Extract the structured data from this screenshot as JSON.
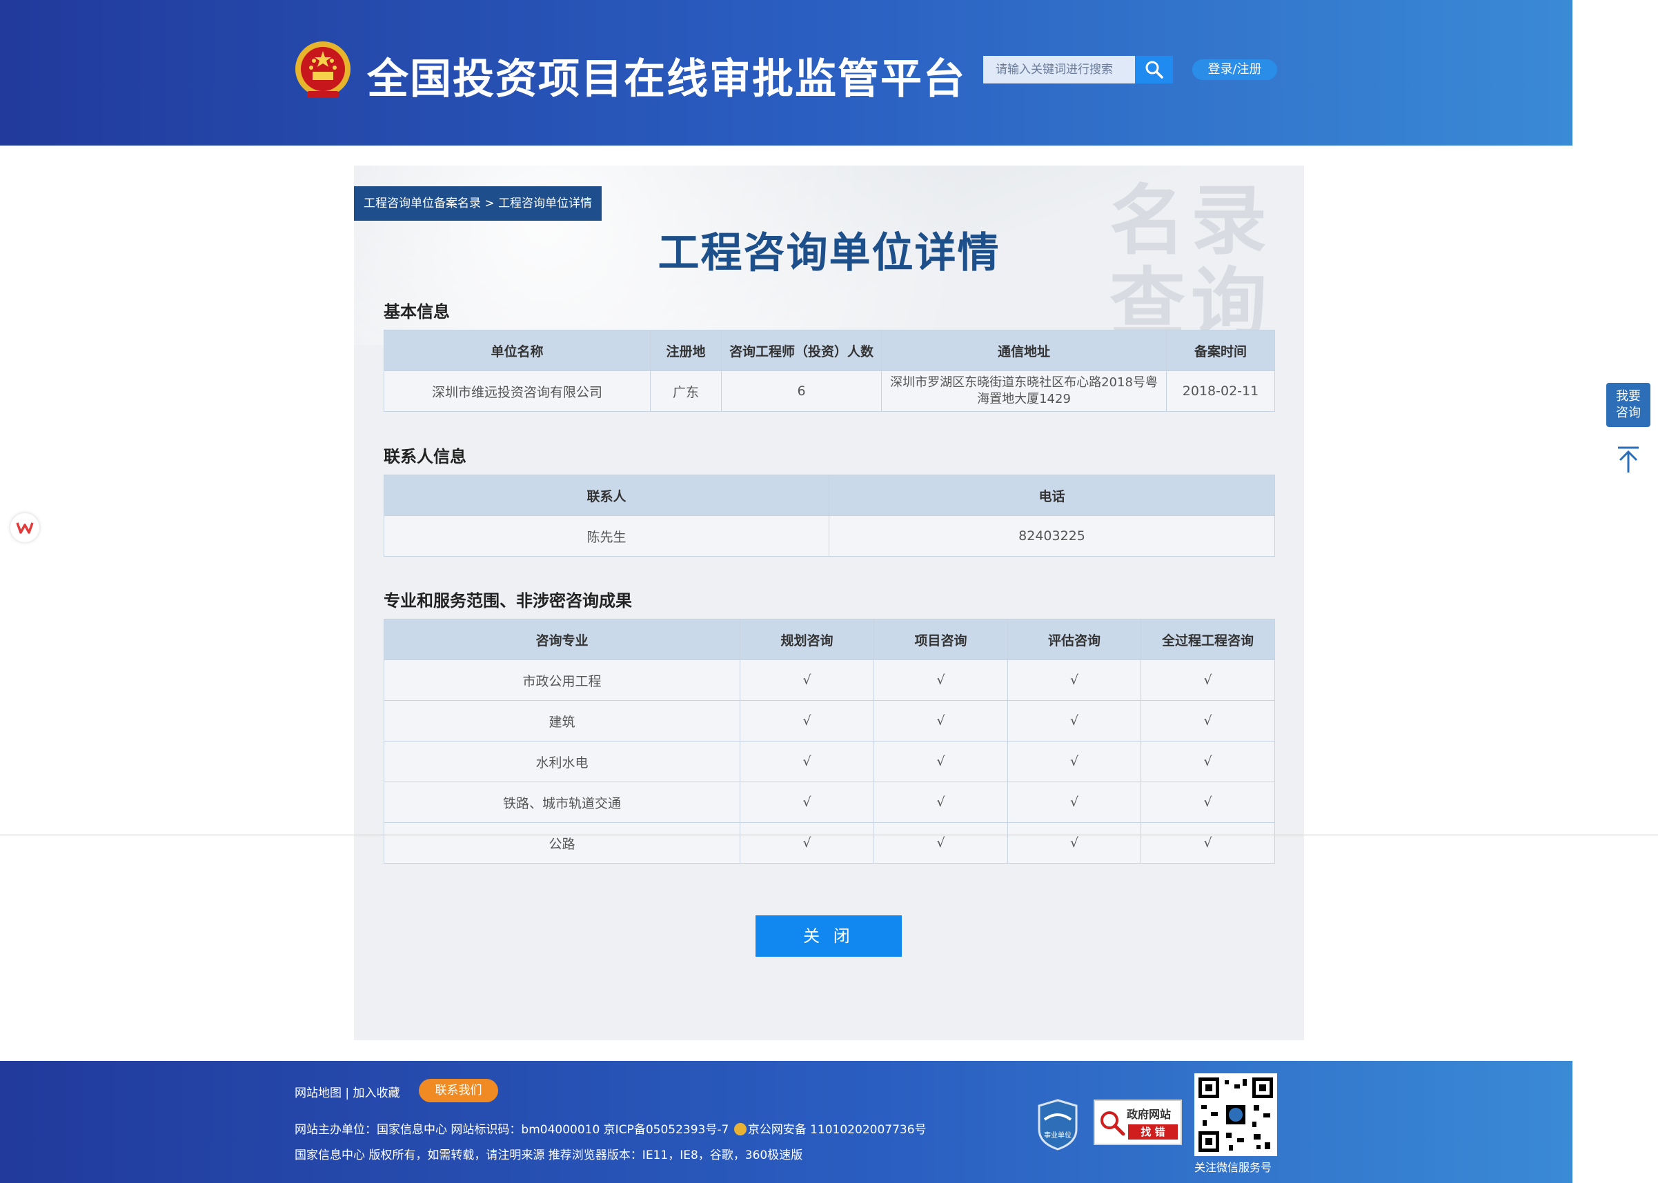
{
  "header": {
    "site_title": "全国投资项目在线审批监管平台",
    "search_placeholder": "请输入关键词进行搜索",
    "login_label": "登录/注册"
  },
  "breadcrumb": {
    "item1": "工程咨询单位备案名录",
    "separator": " > ",
    "item2": "工程咨询单位详情"
  },
  "page_title": "工程咨询单位详情",
  "watermark": "名录查询",
  "basic": {
    "title": "基本信息",
    "headers": [
      "单位名称",
      "注册地",
      "咨询工程师（投资）人数",
      "通信地址",
      "备案时间"
    ],
    "row": [
      "深圳市维远投资咨询有限公司",
      "广东",
      "6",
      "深圳市罗湖区东晓街道东晓社区布心路2018号粤海置地大厦1429",
      "2018-02-11"
    ]
  },
  "contact": {
    "title": "联系人信息",
    "headers": [
      "联系人",
      "电话"
    ],
    "row": [
      "陈先生",
      "82403225"
    ]
  },
  "scope": {
    "title": "专业和服务范围、非涉密咨询成果",
    "headers": [
      "咨询专业",
      "规划咨询",
      "项目咨询",
      "评估咨询",
      "全过程工程咨询"
    ],
    "rows": [
      [
        "市政公用工程",
        "√",
        "√",
        "√",
        "√"
      ],
      [
        "建筑",
        "√",
        "√",
        "√",
        "√"
      ],
      [
        "水利水电",
        "√",
        "√",
        "√",
        "√"
      ],
      [
        "铁路、城市轨道交通",
        "√",
        "√",
        "√",
        "√"
      ],
      [
        "公路",
        "√",
        "√",
        "√",
        "√"
      ]
    ]
  },
  "close_label": "关 闭",
  "side": {
    "consult_line1": "我要",
    "consult_line2": "咨询"
  },
  "footer": {
    "sitemap": "网站地图",
    "divider": " | ",
    "favorite": "加入收藏",
    "contact_us": "联系我们",
    "line1_a": "网站主办单位：国家信息中心    网站标识码：bm04000010    京ICP备05052393号-7 ",
    "line1_b": "京公网安备 11010202007736号",
    "line2": "国家信息中心 版权所有，如需转载，请注明来源    推荐浏览器版本：IE11，IE8，谷歌，360极速版",
    "badge_shiye": "事业单位",
    "badge_zhaocuo_1": "政府网站",
    "badge_zhaocuo_2": "找 错",
    "qr_caption": "关注微信服务号"
  },
  "colors": {
    "header_start": "#213a9c",
    "header_end": "#3a8ad6",
    "title_blue": "#1d4f8a",
    "table_header": "#cad9ea",
    "close_button": "#1088ef",
    "contact_button": "#f08a22"
  }
}
